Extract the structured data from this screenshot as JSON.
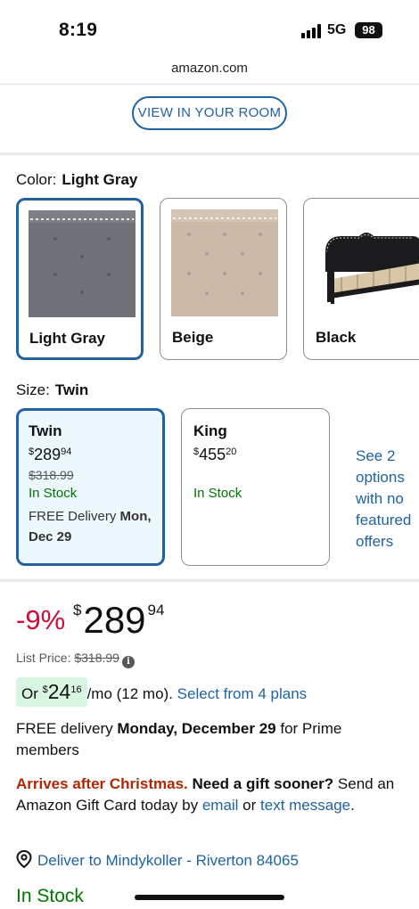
{
  "status_bar": {
    "time": "8:19",
    "network": "5G",
    "battery": "98"
  },
  "browser": {
    "url": "amazon.com"
  },
  "view_room": {
    "label": "VIEW IN YOUR ROOM"
  },
  "color": {
    "label": "Color:",
    "selected": "Light Gray",
    "options": [
      {
        "name": "Light Gray",
        "swatch": "#6e7176"
      },
      {
        "name": "Beige",
        "swatch": "#c9b9a8"
      },
      {
        "name": "Black",
        "swatch": "#1b1b1d"
      }
    ]
  },
  "size": {
    "label": "Size:",
    "selected": "Twin",
    "options": [
      {
        "name": "Twin",
        "currency": "$",
        "price_whole": "289",
        "price_cents": "94",
        "list_price": "$318.99",
        "stock": "In Stock",
        "delivery_prefix": "FREE Delivery ",
        "delivery_date": "Mon, Dec 29"
      },
      {
        "name": "King",
        "currency": "$",
        "price_whole": "455",
        "price_cents": "20",
        "stock": "In Stock"
      }
    ],
    "more_options": "See 2 options with no featured offers"
  },
  "price": {
    "discount": "-9%",
    "currency": "$",
    "whole": "289",
    "cents": "94",
    "list_label": "List Price:",
    "list_value": "$318.99",
    "info_icon": "i"
  },
  "monthly": {
    "prefix": "Or ",
    "currency": "$",
    "whole": "24",
    "cents": "16",
    "suffix": "/mo (12 mo). ",
    "plans_link": "Select from 4 plans"
  },
  "delivery": {
    "prefix": "FREE delivery ",
    "date": "Monday, December 29",
    "suffix": " for Prime members"
  },
  "gift": {
    "warning": "Arrives after Christmas.",
    "question": " Need a gift sooner?",
    "text1": " Send an Amazon Gift Card today by ",
    "email_link": "email",
    "or": " or ",
    "text_link": "text message",
    "period": "."
  },
  "deliver_to": {
    "text": "Deliver to Mindykoller - Riverton 84065",
    "icon": "location-pin-icon"
  },
  "stock_status": "In Stock",
  "colors": {
    "link": "#2162a1",
    "deal_red": "#cc0c39",
    "stock_green": "#007600",
    "selected_border": "#2162a1"
  }
}
